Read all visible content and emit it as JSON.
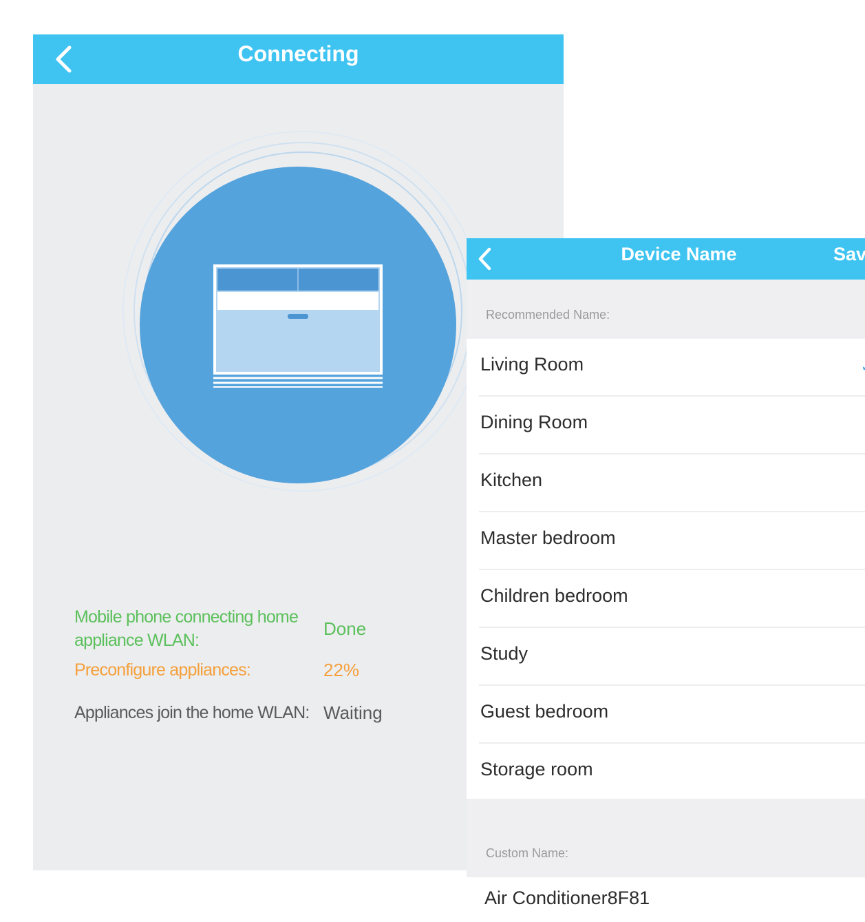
{
  "connecting_screen": {
    "title": "Connecting",
    "header_color": "#3fc4f2",
    "status": [
      {
        "label": "Mobile phone connecting home appliance WLAN:",
        "value": "Done",
        "color": "#5cc05c"
      },
      {
        "label": "Preconfigure appliances:",
        "value": "22%",
        "color": "#f5a03c"
      },
      {
        "label": "Appliances join the home WLAN:",
        "value": "Waiting",
        "color": "#5a5a5a"
      }
    ]
  },
  "device_name_screen": {
    "title": "Device Name",
    "save_label": "Save",
    "recommended_header": "Recommended Name:",
    "recommended_names": [
      {
        "label": "Living Room",
        "selected": true
      },
      {
        "label": "Dining Room",
        "selected": false
      },
      {
        "label": "Kitchen",
        "selected": false
      },
      {
        "label": "Master bedroom",
        "selected": false
      },
      {
        "label": "Children bedroom",
        "selected": false
      },
      {
        "label": "Study",
        "selected": false
      },
      {
        "label": "Guest bedroom",
        "selected": false
      },
      {
        "label": "Storage room",
        "selected": false
      }
    ],
    "custom_header": "Custom Name:",
    "custom_name_value": "Air Conditioner8F81"
  },
  "icons": {
    "back": "chevron-left-icon",
    "device": "air-conditioner-icon",
    "selected": "checkmark-icon"
  }
}
